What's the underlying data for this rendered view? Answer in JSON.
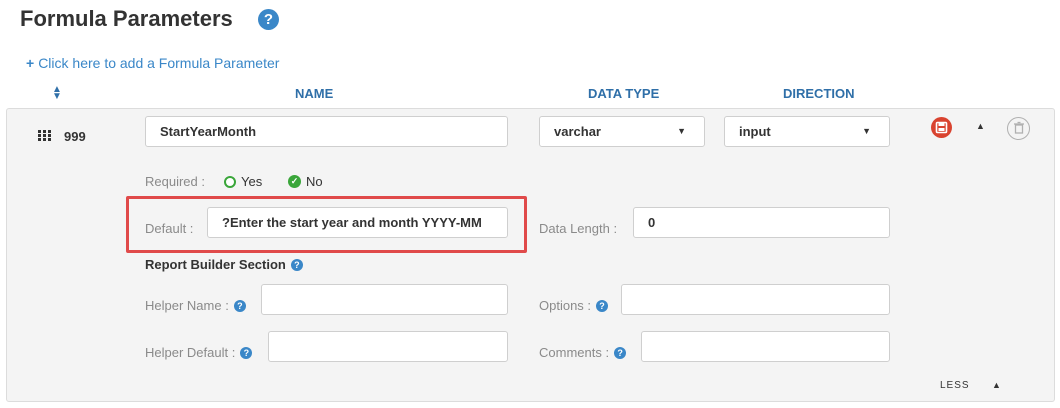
{
  "page": {
    "title": "Formula Parameters",
    "add_link": "Click here to add a Formula Parameter"
  },
  "columns": {
    "name": "NAME",
    "data_type": "DATA TYPE",
    "direction": "DIRECTION"
  },
  "row": {
    "number": "999",
    "name_value": "StartYearMonth",
    "data_type_value": "varchar",
    "direction_value": "input",
    "required_label": "Required :",
    "required_options": [
      "Yes",
      "No"
    ],
    "required_selected": "No",
    "default_label": "Default :",
    "default_value": "?Enter the start year and month YYYY-MM",
    "data_length_label": "Data Length :",
    "data_length_value": "0",
    "report_builder_title": "Report Builder Section",
    "helper_name_label": "Helper Name :",
    "helper_name_value": "",
    "options_label": "Options :",
    "options_value": "",
    "helper_default_label": "Helper Default :",
    "helper_default_value": "",
    "comments_label": "Comments :",
    "comments_value": "",
    "less_label": "LESS"
  },
  "colors": {
    "accent": "#3a87c8",
    "save": "#d9432f",
    "radio": "#3aa63a",
    "highlight": "#e04a4a"
  }
}
